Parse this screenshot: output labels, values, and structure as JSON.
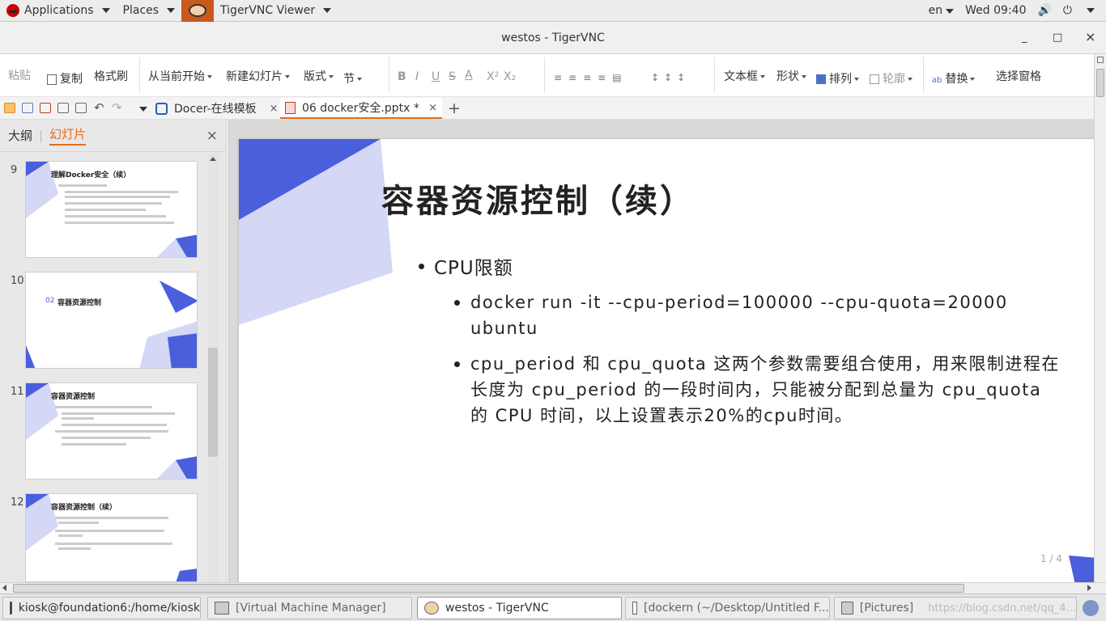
{
  "topbar": {
    "applications": "Applications",
    "places": "Places",
    "app_name": "TigerVNC Viewer",
    "lang": "en",
    "clock": "Wed 09:40"
  },
  "window": {
    "title": "westos - TigerVNC",
    "minimize": "_",
    "maximize": "□",
    "close": "×"
  },
  "ribbon": {
    "paste": "粘贴",
    "copy": "复制",
    "format_painter": "格式刷",
    "from_current": "从当前开始",
    "new_slide": "新建幻灯片",
    "layout": "版式",
    "section": "节",
    "bold": "B",
    "italic": "I",
    "underline": "U",
    "strike": "S",
    "font_color": "A",
    "superscript": "X²",
    "subscript": "X₂",
    "textbox": "文本框",
    "shape": "形状",
    "arrange": "排列",
    "outline": "轮廓",
    "replace": "替换",
    "select_pane": "选择窗格"
  },
  "tabs": [
    {
      "label": "Docer-在线模板",
      "close": "×"
    },
    {
      "label": "06 docker安全.pptx *",
      "close": "×"
    }
  ],
  "new_tab": "+",
  "panel": {
    "outline_tab": "大纲",
    "slides_tab": "幻灯片",
    "divider": "|",
    "close": "×"
  },
  "thumbnails": [
    {
      "num": "9",
      "title": "理解Docker安全（续）"
    },
    {
      "num": "10",
      "title": "容器资源控制",
      "prefix": "02"
    },
    {
      "num": "11",
      "title": "容器资源控制"
    },
    {
      "num": "12",
      "title": "容器资源控制（续）"
    }
  ],
  "slide": {
    "title": "容器资源控制（续）",
    "bullet1": "CPU限额",
    "bullet2": "docker run -it --cpu-period=100000 --cpu-quota=20000 ubuntu",
    "bullet3": "cpu_period 和 cpu_quota 这两个参数需要组合使用，用来限制进程在长度为 cpu_period 的一段时间内，只能被分配到总量为 cpu_quota 的 CPU 时间，以上设置表示20%的cpu时间。",
    "accent_color": "#4a5fdc",
    "light_color": "#d4d8f5"
  },
  "page_indicator": "1 / 4",
  "taskbar": [
    {
      "label": "kiosk@foundation6:/home/kiosk"
    },
    {
      "label": "[Virtual Machine Manager]"
    },
    {
      "label": "westos - TigerVNC"
    },
    {
      "label": "[dockern (~/Desktop/Untitled F..."
    },
    {
      "label": "[Pictures]"
    }
  ],
  "watermark": "https://blog.csdn.net/qq_4..."
}
